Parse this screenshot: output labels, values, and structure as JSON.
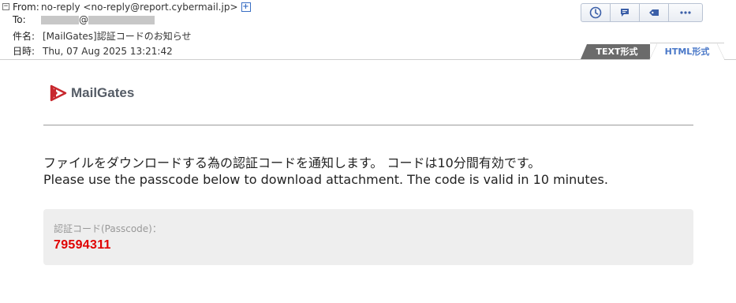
{
  "header": {
    "collapse_icon": "minus-box-icon",
    "from_label": "From:",
    "from_value": "no-reply <no-reply@report.cybermail.jp>",
    "to_label": "To:",
    "to_value_suffix": "@",
    "subject_label": "件名:",
    "subject_value": "[MailGates]認証コードのお知らせ",
    "date_label": "日時:",
    "date_value": "Thu, 07 Aug 2025 13:21:42"
  },
  "toolbar": {
    "buttons": [
      "clock-icon",
      "chat-icon",
      "tag-icon",
      "more-icon"
    ]
  },
  "tabs": {
    "text_tab": "TEXT形式",
    "html_tab": "HTML形式"
  },
  "body": {
    "logo_text": "MailGates",
    "message_ja": "ファイルをダウンロードする為の認証コードを通知します。 コードは10分間有効です。",
    "message_en": "Please use the passcode below to download attachment. The code is valid in 10 minutes.",
    "code_label": "認証コード(Passcode)：",
    "code_value": "79594311"
  },
  "colors": {
    "code": "#e00000",
    "tab_active_text": "#4a78c8",
    "logo_red": "#c8282e",
    "toolbar_icon": "#3b5fa8"
  }
}
